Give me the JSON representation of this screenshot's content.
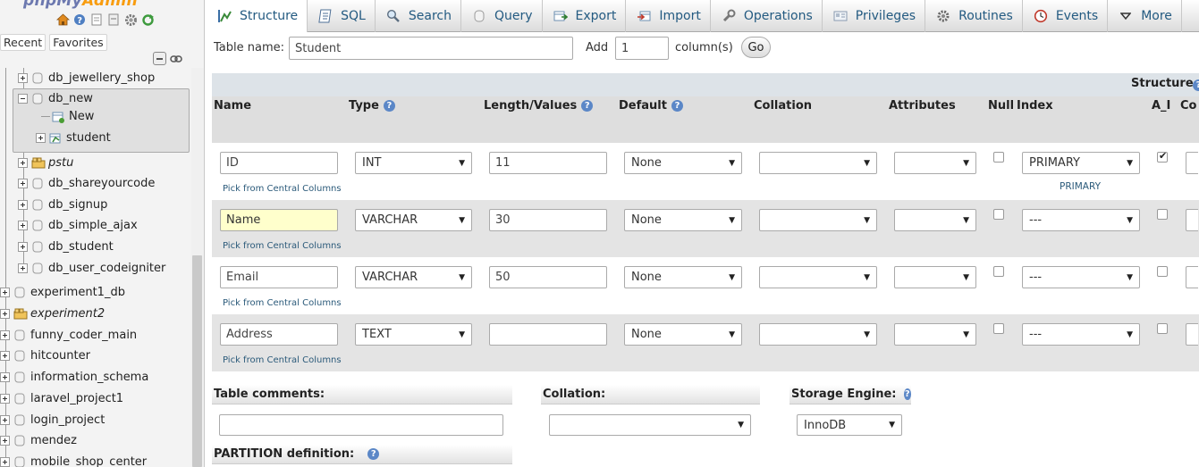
{
  "nav": {
    "logo_main": "phpMy",
    "logo_accent": "Admin",
    "tabs": [
      "Recent",
      "Favorites"
    ],
    "tree": [
      {
        "label": "db_jewellery_shop",
        "italic": false
      },
      {
        "label": "db_new",
        "italic": false
      },
      {
        "label": "New",
        "italic": false
      },
      {
        "label": "student",
        "italic": false
      },
      {
        "label": "pstu",
        "italic": true
      },
      {
        "label": "db_shareyourcode",
        "italic": false
      },
      {
        "label": "db_signup",
        "italic": false
      },
      {
        "label": "db_simple_ajax",
        "italic": false
      },
      {
        "label": "db_student",
        "italic": false
      },
      {
        "label": "db_user_codeigniter",
        "italic": false
      },
      {
        "label": "experiment1_db",
        "italic": false
      },
      {
        "label": "experiment2",
        "italic": true
      },
      {
        "label": "funny_coder_main",
        "italic": false
      },
      {
        "label": "hitcounter",
        "italic": false
      },
      {
        "label": "information_schema",
        "italic": false
      },
      {
        "label": "laravel_project1",
        "italic": false
      },
      {
        "label": "login_project",
        "italic": false
      },
      {
        "label": "mendez",
        "italic": false
      },
      {
        "label": "mobile_shop_center",
        "italic": false
      }
    ]
  },
  "topbar": {
    "tabs": [
      {
        "label": "Structure",
        "icon": "structure-icon"
      },
      {
        "label": "SQL",
        "icon": "sql-icon"
      },
      {
        "label": "Search",
        "icon": "search-icon"
      },
      {
        "label": "Query",
        "icon": "query-icon"
      },
      {
        "label": "Export",
        "icon": "export-icon"
      },
      {
        "label": "Import",
        "icon": "import-icon"
      },
      {
        "label": "Operations",
        "icon": "wrench-icon"
      },
      {
        "label": "Privileges",
        "icon": "privileges-icon"
      },
      {
        "label": "Routines",
        "icon": "routines-icon"
      },
      {
        "label": "Events",
        "icon": "events-icon"
      },
      {
        "label": "More",
        "icon": "triangle-down-icon"
      }
    ]
  },
  "form": {
    "table_name_label": "Table name:",
    "table_name_value": "Student",
    "add_label": "Add",
    "add_count": "1",
    "columns_label": "column(s)",
    "go_label": "Go",
    "structure_label": "Structure",
    "headers": {
      "name": "Name",
      "type": "Type",
      "length": "Length/Values",
      "default": "Default",
      "collation": "Collation",
      "attributes": "Attributes",
      "null": "Null",
      "index": "Index",
      "ai": "A_I",
      "comments": "Co"
    },
    "pick_label": "Pick from Central Columns",
    "rows": [
      {
        "name": "ID",
        "type": "INT",
        "length": "11",
        "default": "None",
        "collation": "",
        "attributes": "",
        "null": false,
        "index": "PRIMARY",
        "index_note": "PRIMARY",
        "ai": true
      },
      {
        "name": "Name",
        "type": "VARCHAR",
        "length": "30",
        "default": "None",
        "collation": "",
        "attributes": "",
        "null": false,
        "index": "---",
        "index_note": "",
        "ai": false
      },
      {
        "name": "Email",
        "type": "VARCHAR",
        "length": "50",
        "default": "None",
        "collation": "",
        "attributes": "",
        "null": false,
        "index": "---",
        "index_note": "",
        "ai": false
      },
      {
        "name": "Address",
        "type": "TEXT",
        "length": "",
        "default": "None",
        "collation": "",
        "attributes": "",
        "null": false,
        "index": "---",
        "index_note": "",
        "ai": false
      }
    ],
    "table_comments_label": "Table comments:",
    "table_comments_value": "",
    "collation_label": "Collation:",
    "collation_value": "",
    "storage_engine_label": "Storage Engine:",
    "storage_engine_value": "InnoDB",
    "partition_label": "PARTITION definition:"
  }
}
